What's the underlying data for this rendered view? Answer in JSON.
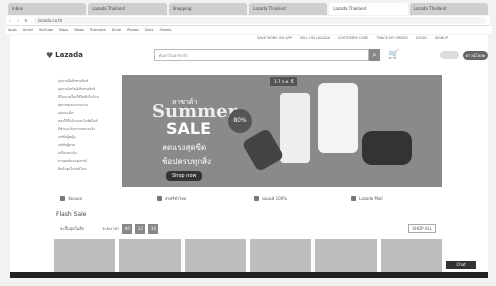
{
  "browser": {
    "tabs": [
      "Inbox",
      "Lazada Thailand",
      "Shopping",
      "Lazada Thailand",
      "Lazada Thailand",
      "Lazada Thailand"
    ],
    "url": "lazada.co.th",
    "bookmarks": [
      "Apps",
      "Gmail",
      "YouTube",
      "Maps",
      "News",
      "Translate",
      "Drive",
      "Photos",
      "Docs",
      "Sheets"
    ]
  },
  "site": {
    "toplinks": [
      "SAVE MORE ON APP",
      "SELL ON LAZADA",
      "CUSTOMER CARE",
      "TRACK MY ORDER",
      "LOGIN",
      "SIGNUP"
    ],
    "logo": "Lazada",
    "search_placeholder": "ค้นหาในลาซาด้า",
    "app_button": "ดาวน์โหลด"
  },
  "categories": [
    "อุปกรณ์อิเล็กทรอนิกส์",
    "อุปกรณ์เสริมอิเล็กทรอนิกส์",
    "ทีวีและเครื่องใช้ไฟฟ้าในบ้าน",
    "สุขภาพและความงาม",
    "แม่และเด็ก",
    "ของใช้ในบ้านและไลฟ์สไตล์",
    "กีฬาและกิจกรรมกลางแจ้ง",
    "แฟชั่นผู้หญิง",
    "แฟชั่นผู้ชาย",
    "เครื่องประดับ",
    "ยานยนต์และอุปกรณ์",
    "สินค้าอุปโภคบริโภค"
  ],
  "banner": {
    "sticker": "1-7 ก.ค. นี้",
    "small": "ลาซาด้า",
    "summer": "Summer",
    "sale": "SALE",
    "percent": "80%",
    "line1": "ลดแรงสุดขีด",
    "line2": "ช้อปครบทุกสิ่ง",
    "shop": "Shop now"
  },
  "features": [
    "ช้อปเลย",
    "ส่งฟรีทั่วไทย",
    "ของแท้ 100%",
    "Lazada Mall"
  ],
  "flash_sale": {
    "title": "Flash Sale",
    "ends_label": "จะสิ้นสุดในอีก",
    "time_label": "ระยะเวลา",
    "timer": [
      "00",
      "12",
      "34"
    ],
    "shop_all": "SHOP ALL"
  },
  "chat_label": "Chat"
}
